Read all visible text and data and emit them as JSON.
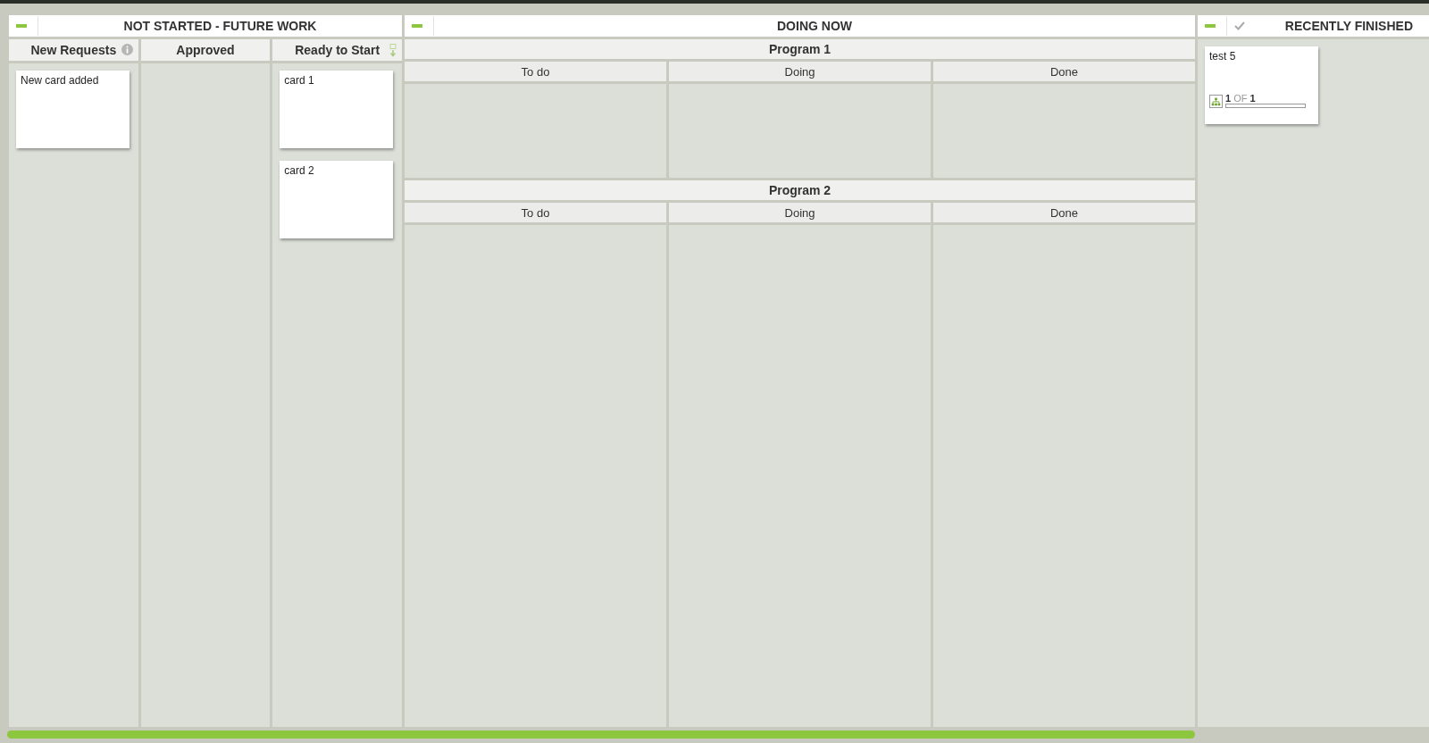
{
  "sections": [
    {
      "kind": "lanes",
      "title": "NOT STARTED - FUTURE WORK",
      "lanes": [
        {
          "title": "New Requests",
          "kind": "info",
          "cards": [
            {
              "title": "New card added"
            }
          ]
        },
        {
          "title": "Approved",
          "kind": "plain"
        },
        {
          "title": "Ready to Start",
          "kind": "ready",
          "cards": [
            {
              "title": "card 1"
            },
            {
              "title": "card 2"
            }
          ]
        }
      ]
    },
    {
      "kind": "programs",
      "title": "DOING NOW",
      "programs": [
        {
          "title": "Program 1",
          "lanes": [
            {
              "title": "To do"
            },
            {
              "title": "Doing"
            },
            {
              "title": "Done"
            }
          ]
        },
        {
          "title": "Program 2",
          "lanes": [
            {
              "title": "To do"
            },
            {
              "title": "Doing"
            },
            {
              "title": "Done"
            }
          ]
        }
      ]
    },
    {
      "kind": "finished",
      "title": "RECENTLY FINISHED",
      "cards": [
        {
          "title": "test 5",
          "progress": {
            "done": "1",
            "of": "OF",
            "total": "1",
            "level": 0
          }
        }
      ]
    }
  ]
}
